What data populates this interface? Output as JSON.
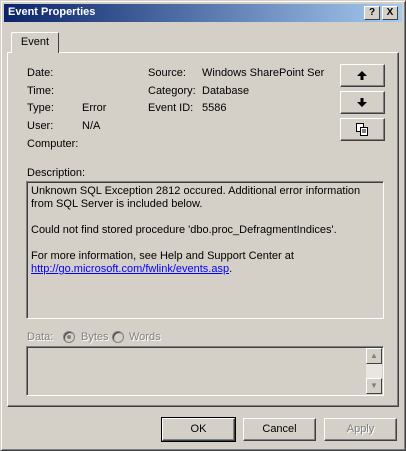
{
  "window": {
    "title": "Event Properties",
    "help_btn": "?",
    "close_btn": "X"
  },
  "tab": {
    "label": "Event"
  },
  "fields": {
    "date_label": "Date:",
    "time_label": "Time:",
    "type_label": "Type:",
    "type_value": "Error",
    "user_label": "User:",
    "user_value": "N/A",
    "computer_label": "Computer:",
    "source_label": "Source:",
    "source_value": "Windows SharePoint Ser",
    "category_label": "Category:",
    "category_value": "Database",
    "eventid_label": "Event ID:",
    "eventid_value": "5586"
  },
  "nav": {
    "up_icon": "arrow-up-icon",
    "down_icon": "arrow-down-icon",
    "copy_icon": "copy-icon"
  },
  "description": {
    "label": "Description:",
    "line1": "Unknown SQL Exception 2812 occured. Additional error information from SQL Server is included below.",
    "line2": "Could not find stored procedure 'dbo.proc_DefragmentIndices'.",
    "line3": "For more information, see Help and Support Center at",
    "link": "http://go.microsoft.com/fwlink/events.asp",
    "link_suffix": "."
  },
  "data": {
    "label": "Data:",
    "bytes_label": "Bytes",
    "words_label": "Words"
  },
  "buttons": {
    "ok": "OK",
    "cancel": "Cancel",
    "apply": "Apply"
  }
}
